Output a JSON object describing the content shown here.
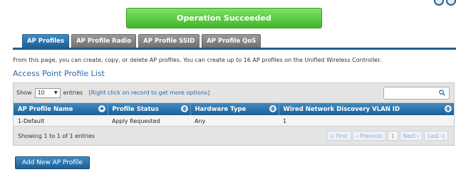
{
  "banner": {
    "message": "Operation Succeeded"
  },
  "tabs": [
    {
      "label": "AP Profiles",
      "active": true
    },
    {
      "label": "AP Profile Radio",
      "active": false
    },
    {
      "label": "AP Profile SSID",
      "active": false
    },
    {
      "label": "AP Profile QoS",
      "active": false
    }
  ],
  "description": "From this page, you can create, copy, or delete AP profiles. You can create up to 16 AP profiles on the Unified Wireless Controller.",
  "list_title": "Access Point Profile List",
  "toolbar": {
    "show_label": "Show",
    "page_size": "10",
    "entries_label": "entries",
    "hint": "[Right click on record to get more options]",
    "search_value": ""
  },
  "table": {
    "columns": [
      "AP Profile Name",
      "Profile Status",
      "Hardware Type",
      "Wired Network Discovery VLAN ID"
    ],
    "rows": [
      [
        "1-Default",
        "Apply Requested",
        "Any",
        "1"
      ]
    ]
  },
  "footer": {
    "info": "Showing 1 to 1 of 1 entries",
    "pager": {
      "first": "First",
      "previous": "Previous",
      "current": "1",
      "next": "Next",
      "last": "Last"
    }
  },
  "add_button": {
    "label": "Add New AP Profile"
  },
  "colors": {
    "accent": "#1e5f93",
    "success": "#3fb82a",
    "tab_inactive": "#808080"
  },
  "icons": {
    "search": "search-icon",
    "sort": "sort-icon"
  }
}
